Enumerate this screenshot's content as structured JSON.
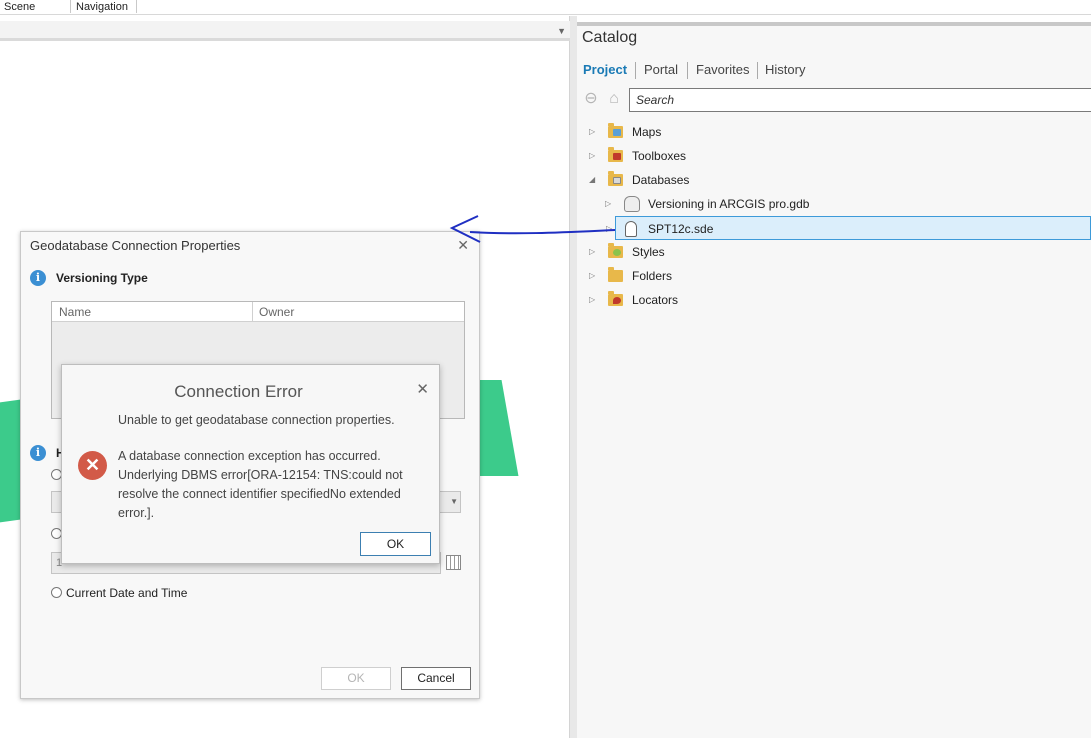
{
  "ribbon": {
    "tabs": [
      "Scene",
      "Navigation"
    ]
  },
  "catalog": {
    "title": "Catalog",
    "tabs": [
      "Project",
      "Portal",
      "Favorites",
      "History"
    ],
    "active_tab": "Project",
    "search_placeholder": "Search",
    "tree": [
      {
        "label": "Maps",
        "icon": "maps-folder-icon",
        "level": 0,
        "expanded": false
      },
      {
        "label": "Toolboxes",
        "icon": "toolboxes-folder-icon",
        "level": 0,
        "expanded": false
      },
      {
        "label": "Databases",
        "icon": "databases-folder-icon",
        "level": 0,
        "expanded": true
      },
      {
        "label": "Versioning in ARCGIS pro.gdb",
        "icon": "geodatabase-icon",
        "level": 1,
        "expanded": false
      },
      {
        "label": "SPT12c.sde",
        "icon": "database-connection-icon",
        "level": 1,
        "expanded": false,
        "selected": true
      },
      {
        "label": "Styles",
        "icon": "styles-folder-icon",
        "level": 0,
        "expanded": false
      },
      {
        "label": "Folders",
        "icon": "folders-folder-icon",
        "level": 0,
        "expanded": false
      },
      {
        "label": "Locators",
        "icon": "locators-folder-icon",
        "level": 0,
        "expanded": false
      }
    ]
  },
  "dialog": {
    "title": "Geodatabase Connection Properties",
    "versioning_type_label": "Versioning Type",
    "columns": [
      "Name",
      "Owner"
    ],
    "historical_label_fragment": "H",
    "date_value_fragment": "1",
    "current_date_label": "Current Date and Time",
    "ok_label": "OK",
    "cancel_label": "Cancel"
  },
  "error": {
    "title": "Connection Error",
    "line1": "Unable to get geodatabase connection properties.",
    "line2": "A database connection exception has occurred. Underlying DBMS error[ORA-12154: TNS:could not resolve the connect identifier specifiedNo extended error.].",
    "ok_label": "OK"
  },
  "colors": {
    "accent": "#1a7ab5",
    "selection": "#dbeefb",
    "error_icon": "#d25a48",
    "info_icon": "#3b8fd3",
    "green_shape": "#3ccb8b",
    "annotation_arrow": "#1f2fc2"
  }
}
